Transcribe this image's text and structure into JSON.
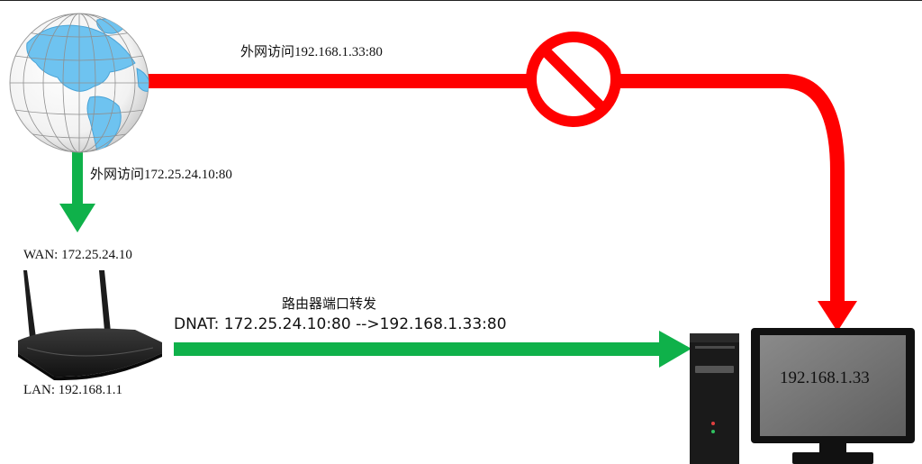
{
  "labels": {
    "external_to_lan": "外网访问192.168.1.33:80",
    "external_to_wan": "外网访问172.25.24.10:80",
    "wan": "WAN: 172.25.24.10",
    "lan": "LAN: 192.168.1.1",
    "port_forward_title": "路由器端口转发",
    "dnat_rule": "DNAT: 172.25.24.10:80 -->192.168.1.33:80",
    "monitor_ip": "192.168.1.33"
  },
  "colors": {
    "blocked_path": "#ff0000",
    "allowed_path": "#0fb14a",
    "globe_ocean": "#ffffff",
    "globe_land": "#6ec3f0",
    "device_body": "#1a1a1a",
    "monitor_screen": "#6e6e6e"
  },
  "icons": {
    "globe": "globe-icon",
    "router": "router-icon",
    "tower": "pc-tower-icon",
    "monitor": "monitor-icon",
    "prohibited": "no-entry-icon"
  }
}
